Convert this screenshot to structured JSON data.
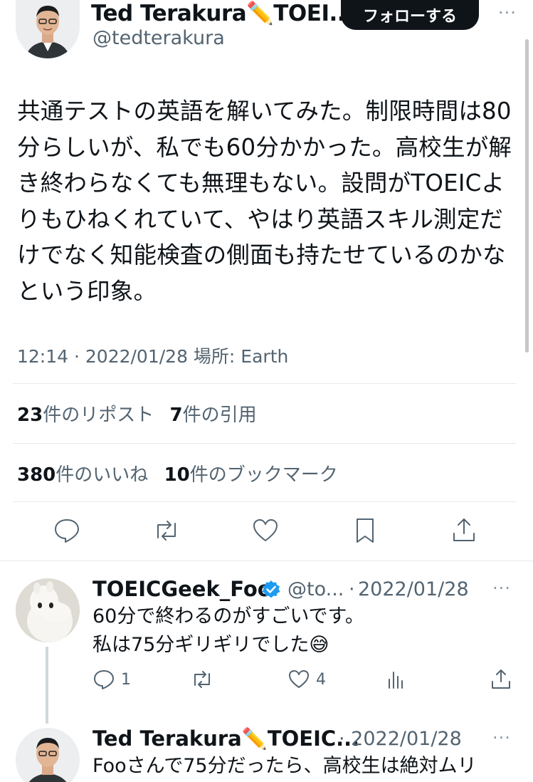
{
  "header": {
    "display_name": "Ted Terakura✏️TOEI...",
    "handle": "@tedterakura",
    "follow_label": "フォローする",
    "more": "···"
  },
  "tweet": {
    "text": "共通テストの英語を解いてみた。制限時間は80分らしいが、私でも60分かかった。高校生が解き終わらなくても無理もない。設問がTOEICよりもひねくれていて、やはり英語スキル測定だけでなく知能検査の側面も持たせているのかなという印象。",
    "meta": "12:14 · 2022/01/28 場所: Earth"
  },
  "stats": {
    "reposts_count": "23",
    "reposts_label": "件のリポスト",
    "quotes_count": "7",
    "quotes_label": "件の引用",
    "likes_count": "380",
    "likes_label": "件のいいね",
    "bookmarks_count": "10",
    "bookmarks_label": "件のブックマーク"
  },
  "icons": {
    "reply": "reply-icon",
    "retweet": "retweet-icon",
    "like": "heart-icon",
    "bookmark": "bookmark-icon",
    "share": "share-icon",
    "analytics": "analytics-icon",
    "verified": "verified-badge-icon"
  },
  "replies": [
    {
      "name": "TOEICGeek_Foo",
      "handle": "@to...",
      "date": "2022/01/28",
      "lines": [
        "60分で終わるのがすごいです。",
        "私は75分ギリギリでした😅"
      ],
      "reply_count": "1",
      "like_count": "4",
      "more": "···"
    },
    {
      "name": "Ted Terakura✏️TOEIC...",
      "date": "· 2022/01/28",
      "lines": [
        "Fooさんで75分だったら、高校生は絶対ムリ"
      ],
      "more": "···"
    }
  ],
  "colors": {
    "text": "#0f1419",
    "secondary": "#536471",
    "verified": "#1d9bf0",
    "divider": "#e6e9eb"
  }
}
